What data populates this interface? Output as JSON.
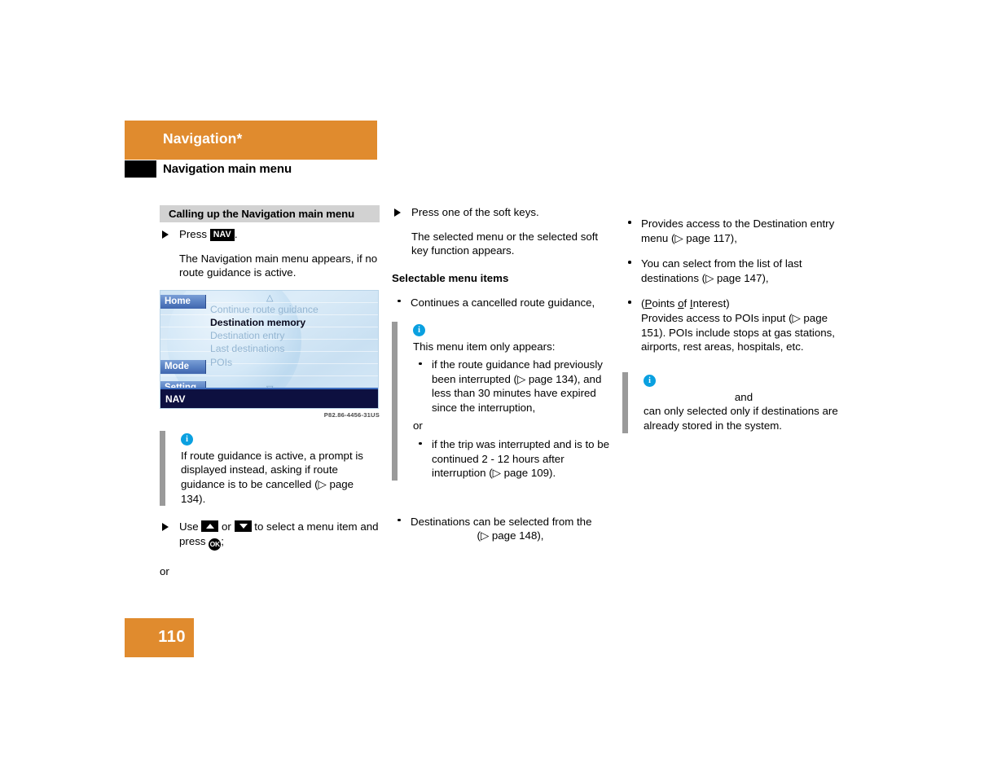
{
  "header": {
    "chapter_title": "Navigation*",
    "section_title": "Navigation main menu",
    "orange": "#e08b2e"
  },
  "left_column": {
    "section_heading": "Calling up the Navigation main menu",
    "step1_prefix": "Press ",
    "step1_key": "NAV",
    "step1_suffix": ".",
    "step1_result": "The Navigation main menu appears, if no route guidance is active.",
    "figure": {
      "softkeys": [
        "Home",
        "Mode",
        "Setting"
      ],
      "menu_items": [
        "Continue route guidance",
        "Destination memory",
        "Destination entry",
        "Last destinations",
        "POIs"
      ],
      "selected_item": "Destination memory",
      "status_bar": "NAV",
      "scroll_up_icon": "triangle-up-icon",
      "scroll_down_icon": "triangle-down-icon",
      "caption": "P82.86-4456-31US"
    },
    "note": {
      "icon": "info-icon",
      "text": "If route guidance is active, a prompt is displayed instead, asking if route guidance is to be cancelled (▷ page 134)."
    },
    "step2_prefix": "Use ",
    "step2_mid": " or ",
    "step2_after_arrows": " to select a menu item and press ",
    "step2_ok_key": "OK",
    "step2_suffix": ";",
    "or_text": "or"
  },
  "middle_column": {
    "step1": "Press one of the soft keys.",
    "step1_result": "The selected menu or the selected soft key function appears.",
    "subhead": "Selectable menu items",
    "bullet1_text": "Continues a cancelled route guidance,",
    "note": {
      "icon": "info-icon",
      "intro": "This menu item only appears:",
      "items": [
        "if the route guidance had previously been interrupted (▷ page 134), and less than 30 minutes have expired since the interruption,",
        "if the trip was interrupted and is to be continued 2 - 12 hours after interruption (▷ page 109)."
      ],
      "or_text": "or"
    },
    "bullet2_line1": "Destinations can be selected from the",
    "bullet2_line2": "(▷ page 148),"
  },
  "right_column": {
    "bullet1": "Provides access to the Destination entry menu (▷ page 117),",
    "bullet2": "You can select from the list of last destinations (▷ page 147),",
    "bullet3_title_open": "(",
    "bullet3_p": "P",
    "bullet3_oints": "oints ",
    "bullet3_o": "o",
    "bullet3_f": "f ",
    "bullet3_i": "I",
    "bullet3_nterest": "nterest)",
    "bullet3_body": "Provides access to POIs input (▷ page 151). POIs include stops at gas stations, airports, rest areas, hospitals, etc.",
    "note": {
      "icon": "info-icon",
      "line1": "and",
      "line2": "can only selected only if destinations are already stored in the system."
    }
  },
  "footer": {
    "page_number": "110"
  }
}
